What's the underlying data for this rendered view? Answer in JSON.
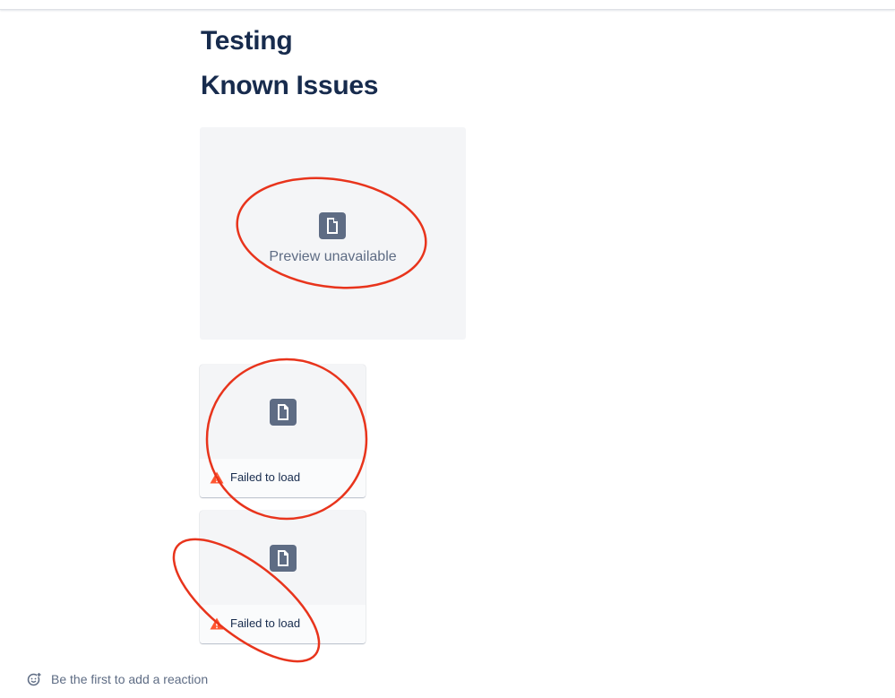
{
  "page": {
    "headings": [
      "Testing",
      "Known Issues"
    ]
  },
  "preview": {
    "message": "Preview unavailable",
    "icon": "file-icon"
  },
  "attachments": [
    {
      "status": "Failed to load",
      "icon": "file-icon",
      "status_icon": "warning-icon"
    },
    {
      "status": "Failed to load",
      "icon": "file-icon",
      "status_icon": "warning-icon"
    }
  ],
  "reactions": {
    "prompt": "Be the first to add a reaction",
    "icon": "add-reaction-icon"
  },
  "colors": {
    "heading": "#172B4D",
    "muted": "#5E6C84",
    "card_bg": "#F4F5F7",
    "warning": "#FF5630",
    "annotation": "#E8341C"
  }
}
